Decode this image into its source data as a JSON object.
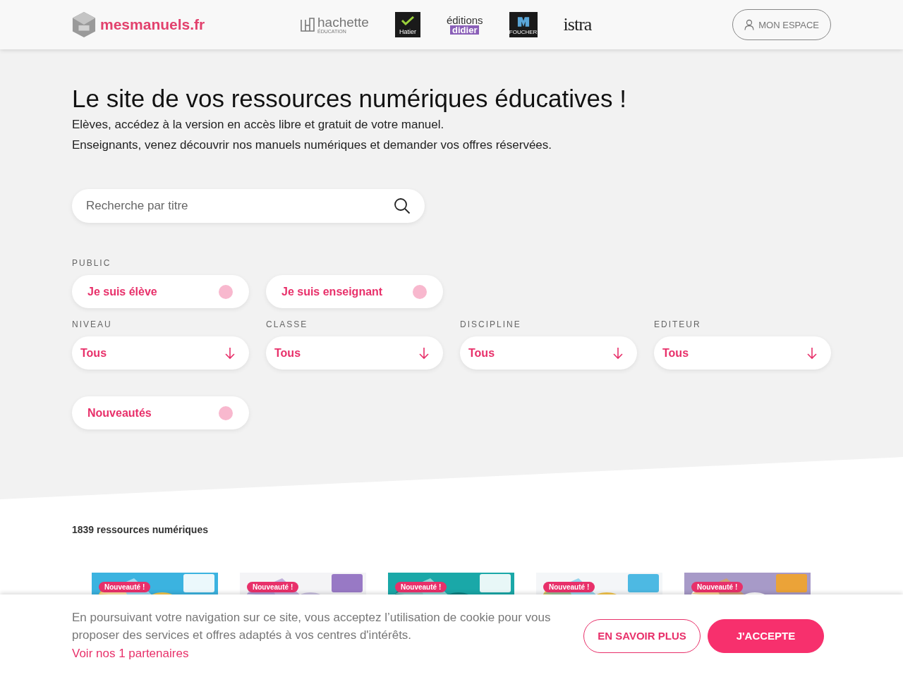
{
  "header": {
    "logo": "mesmanuels.fr",
    "publishers": [
      {
        "kind": "hachette",
        "name": "hachette",
        "sub": "ÉDUCATION"
      },
      {
        "kind": "hatier",
        "name": "Hatier"
      },
      {
        "kind": "didier",
        "name": "éditions",
        "sub": "didier"
      },
      {
        "kind": "foucher",
        "name": "FOUCHER"
      },
      {
        "kind": "istra",
        "name": "istra"
      }
    ],
    "account_button": "MON ESPACE"
  },
  "hero": {
    "title": "Le site de vos ressources numériques éducatives !",
    "lines": [
      "Elèves, accédez à la version en accès libre et gratuit de votre manuel.",
      "Enseignants, venez découvrir nos manuels numériques et demander vos offres réservées."
    ]
  },
  "search": {
    "placeholder": "Recherche par titre"
  },
  "filters": {
    "public_label": "PUBLIC",
    "public": [
      {
        "label": "Je suis élève",
        "on": false
      },
      {
        "label": "Je suis enseignant",
        "on": false
      }
    ],
    "selects": [
      {
        "label": "NIVEAU",
        "value": "Tous"
      },
      {
        "label": "CLASSE",
        "value": "Tous"
      },
      {
        "label": "DISCIPLINE",
        "value": "Tous"
      },
      {
        "label": "EDITEUR",
        "value": "Tous"
      }
    ],
    "new_toggle": {
      "label": "Nouveautés",
      "on": false
    }
  },
  "results": {
    "count": "1839 ressources numériques",
    "books": [
      {
        "badge": "Nouveauté !"
      },
      {
        "badge": "Nouveauté !"
      },
      {
        "badge": "Nouveauté !"
      },
      {
        "badge": "Nouveauté !"
      },
      {
        "badge": "Nouveauté !"
      }
    ]
  },
  "cookie": {
    "text": "En poursuivant votre navigation sur ce site, vous acceptez l’utilisation de cookie pour vous proposer des services et offres adaptés à vos centres d'intérêts.",
    "link": "Voir nos 1 partenaires",
    "buttons": [
      {
        "kind": "outline",
        "label": "EN SAVOIR PLUS"
      },
      {
        "kind": "filled",
        "label": "J'ACCEPTE"
      }
    ]
  }
}
